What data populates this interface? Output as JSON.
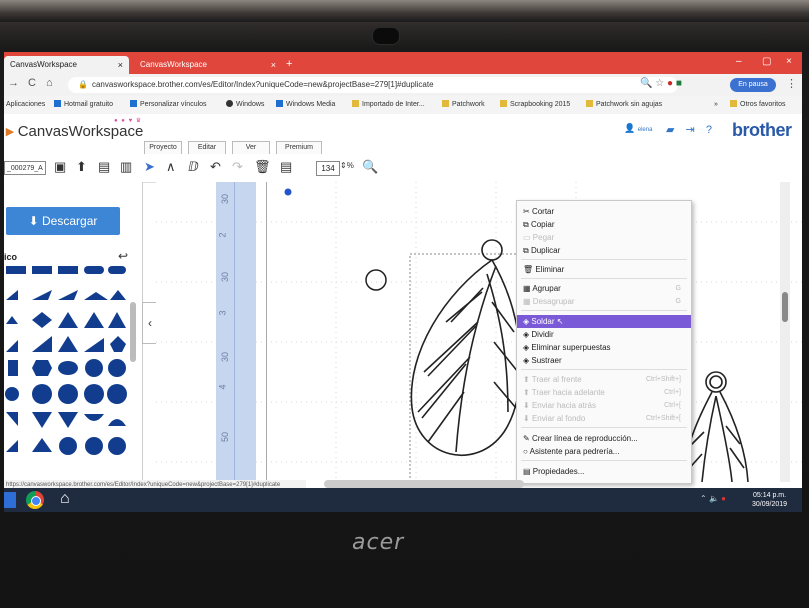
{
  "browser": {
    "tabs": [
      {
        "label": "CanvasWorkspace",
        "close": "×"
      },
      {
        "label": "CanvasWorkspace",
        "close": "×"
      }
    ],
    "new_tab": "+",
    "window_buttons": {
      "minimize": "–",
      "maximize": "▢",
      "close": "×"
    },
    "url": "canvasworkspace.brother.com/es/Editor/Index?uniqueCode=new&projectBase=279[1]#duplicate",
    "pause_label": "En pausa",
    "bookmarks": [
      "Aplicaciones",
      "Hotmail gratuito",
      "Personalizar vínculos",
      "Windows",
      "Windows Media",
      "Importado de Inter...",
      "Patchwork",
      "Scrapbooking 2015",
      "Patchwork sin agujas",
      "»",
      "Otros favoritos"
    ]
  },
  "app": {
    "title": "CanvasWorkspace",
    "brand": "brother",
    "user": "elena",
    "menu_tabs": [
      "Proyecto",
      "Editar",
      "Ver",
      "Premium"
    ],
    "doc_name": "_000279_A",
    "zoom_value": "134",
    "zoom_unit": "%",
    "download_label": "Descargar",
    "panel_title": "ico",
    "collapse_glyph": "‹"
  },
  "ruler": {
    "labels": [
      "30",
      "2",
      "30",
      "3",
      "30",
      "4",
      "50"
    ]
  },
  "context_menu": {
    "items": [
      {
        "label": "Cortar",
        "icon": "✂",
        "disabled": false,
        "selected": false,
        "shortcut": ""
      },
      {
        "label": "Copiar",
        "icon": "⧉",
        "disabled": false,
        "selected": false,
        "shortcut": ""
      },
      {
        "label": "Pegar",
        "icon": "▭",
        "disabled": true,
        "selected": false,
        "shortcut": ""
      },
      {
        "label": "Duplicar",
        "icon": "⧉",
        "disabled": false,
        "selected": false,
        "shortcut": ""
      },
      {
        "label": "Eliminar",
        "icon": "🗑",
        "disabled": false,
        "selected": false,
        "shortcut": ""
      },
      {
        "label": "Agrupar",
        "icon": "▦",
        "disabled": false,
        "selected": false,
        "shortcut": "G"
      },
      {
        "label": "Desagrupar",
        "icon": "▦",
        "disabled": true,
        "selected": false,
        "shortcut": "G"
      },
      {
        "label": "Soldar",
        "icon": "◈",
        "disabled": false,
        "selected": true,
        "shortcut": ""
      },
      {
        "label": "Dividir",
        "icon": "◈",
        "disabled": false,
        "selected": false,
        "shortcut": ""
      },
      {
        "label": "Eliminar superpuestas",
        "icon": "◈",
        "disabled": false,
        "selected": false,
        "shortcut": ""
      },
      {
        "label": "Sustraer",
        "icon": "◈",
        "disabled": false,
        "selected": false,
        "shortcut": ""
      },
      {
        "label": "Traer al frente",
        "icon": "⬆",
        "disabled": true,
        "selected": false,
        "shortcut": "Ctrl+Shift+]"
      },
      {
        "label": "Traer hacia adelante",
        "icon": "⬆",
        "disabled": true,
        "selected": false,
        "shortcut": "Ctrl+]"
      },
      {
        "label": "Enviar hacia atrás",
        "icon": "⬇",
        "disabled": true,
        "selected": false,
        "shortcut": "Ctrl+["
      },
      {
        "label": "Enviar al fondo",
        "icon": "⬇",
        "disabled": true,
        "selected": false,
        "shortcut": "Ctrl+Shift+["
      },
      {
        "label": "Crear línea de reproducción...",
        "icon": "✎",
        "disabled": false,
        "selected": false,
        "shortcut": ""
      },
      {
        "label": "Asistente para pedrería...",
        "icon": "○",
        "disabled": false,
        "selected": false,
        "shortcut": ""
      },
      {
        "label": "Propiedades...",
        "icon": "▤",
        "disabled": false,
        "selected": false,
        "shortcut": ""
      }
    ]
  },
  "status_url": "https://canvasworkspace.brother.com/es/Editor/Index?uniqueCode=new&projectBase=279[1]#duplicate",
  "taskbar": {
    "time": "05:14 p.m.",
    "date": "30/09/2019"
  },
  "laptop": {
    "logo": "acer"
  },
  "colors": {
    "tabbar": "#e0463c",
    "accent": "#3d86d6",
    "menu_selected": "#7b5ad8",
    "ruler": "#c7d6ef",
    "brand": "#2a5aa7"
  }
}
